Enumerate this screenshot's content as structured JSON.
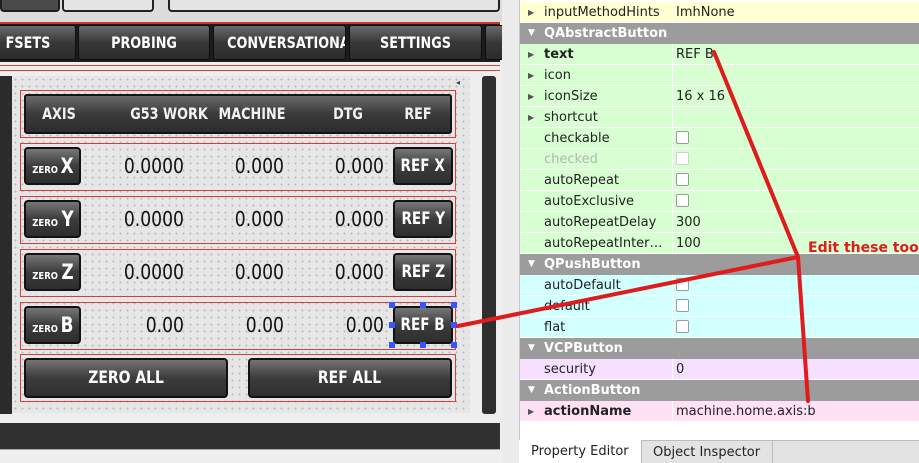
{
  "tabs": [
    {
      "label": "FSETS"
    },
    {
      "label": "PROBING"
    },
    {
      "label": "CONVERSATIONAL"
    },
    {
      "label": "SETTINGS"
    }
  ],
  "dro": {
    "headers": [
      "AXIS",
      "G53 WORK",
      "MACHINE",
      "DTG",
      "REF"
    ],
    "rows": [
      {
        "zero_prefix": "ZERO",
        "axis": "X",
        "g53": "0.0000",
        "machine": "0.000",
        "dtg": "0.000",
        "ref": "REF X"
      },
      {
        "zero_prefix": "ZERO",
        "axis": "Y",
        "g53": "0.0000",
        "machine": "0.000",
        "dtg": "0.000",
        "ref": "REF Y"
      },
      {
        "zero_prefix": "ZERO",
        "axis": "Z",
        "g53": "0.0000",
        "machine": "0.000",
        "dtg": "0.000",
        "ref": "REF Z"
      },
      {
        "zero_prefix": "ZERO",
        "axis": "B",
        "g53": "0.00",
        "machine": "0.00",
        "dtg": "0.00",
        "ref": "REF B"
      }
    ],
    "zero_all": "ZERO ALL",
    "ref_all": "REF ALL"
  },
  "properties": {
    "rows": [
      {
        "type": "prop",
        "name": "inputMethodHints",
        "value": "ImhNone",
        "color": "#ffffd2"
      },
      {
        "type": "section",
        "title": "QAbstractButton"
      },
      {
        "type": "prop",
        "name": "text",
        "value": "REF B",
        "bold": true,
        "color": "#d7ffd2"
      },
      {
        "type": "prop",
        "name": "icon",
        "value": "",
        "color": "#d7ffd2"
      },
      {
        "type": "prop",
        "name": "iconSize",
        "value": "16 x 16",
        "color": "#d7ffd2"
      },
      {
        "type": "prop",
        "name": "shortcut",
        "value": "",
        "color": "#d7ffd2"
      },
      {
        "type": "prop",
        "name": "checkable",
        "checkbox": true,
        "color": "#d7ffd2"
      },
      {
        "type": "prop",
        "name": "checked",
        "checkbox": true,
        "disabled": true,
        "color": "#d7ffd2"
      },
      {
        "type": "prop",
        "name": "autoRepeat",
        "checkbox": true,
        "color": "#d7ffd2"
      },
      {
        "type": "prop",
        "name": "autoExclusive",
        "checkbox": true,
        "color": "#d7ffd2"
      },
      {
        "type": "prop",
        "name": "autoRepeatDelay",
        "value": "300",
        "color": "#d7ffd2"
      },
      {
        "type": "prop",
        "name": "autoRepeatInter…",
        "value": "100",
        "color": "#d7ffd2"
      },
      {
        "type": "section",
        "title": "QPushButton"
      },
      {
        "type": "prop",
        "name": "autoDefault",
        "checkbox": true,
        "color": "#d2ffff"
      },
      {
        "type": "prop",
        "name": "default",
        "checkbox": true,
        "color": "#d2ffff"
      },
      {
        "type": "prop",
        "name": "flat",
        "checkbox": true,
        "color": "#d2ffff"
      },
      {
        "type": "section",
        "title": "VCPButton"
      },
      {
        "type": "prop",
        "name": "security",
        "value": "0",
        "color": "#f5e1ff"
      },
      {
        "type": "section",
        "title": "ActionButton"
      },
      {
        "type": "prop",
        "name": "actionName",
        "value": "machine.home.axis:b",
        "bold": true,
        "color": "#ffe1f5"
      }
    ]
  },
  "bottom_tabs": [
    "Property Editor",
    "Object Inspector"
  ],
  "annotation": {
    "text": "Edit these too",
    "color": "#e01b1b"
  }
}
